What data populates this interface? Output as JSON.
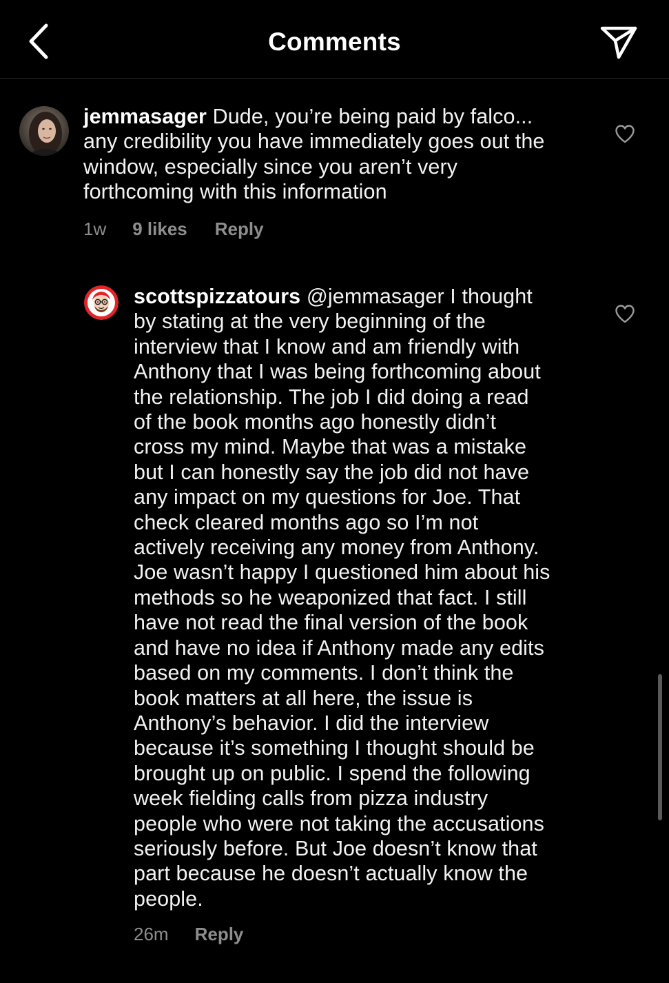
{
  "header": {
    "title": "Comments",
    "back_icon": "chevron-left-icon",
    "share_icon": "paper-plane-icon"
  },
  "comments": [
    {
      "username": "jemmasager",
      "text": "Dude, you’re being paid by falco...\nany credibility you have immediately goes out the\nwindow, especially since you aren’t very\nforthcoming with this information",
      "time": "1w",
      "likes": "9 likes",
      "reply_label": "Reply"
    },
    {
      "username": "scottspizzatours",
      "text": "@jemmasager I thought\nby stating at the very beginning of the\ninterview that I know and am friendly with\nAnthony that I was being forthcoming about\nthe relationship. The job I did doing a read\nof the book months ago honestly didn’t\ncross my mind. Maybe that was a mistake\nbut I can honestly say the job did not have\nany impact on my questions for Joe. That\ncheck cleared months ago so I’m not\nactively receiving any money from Anthony.\nJoe wasn’t happy I questioned him about his\nmethods so he weaponized that fact. I still\nhave not read the final version of the book\nand have no idea if Anthony made any edits\nbased on my comments. I don’t think the\nbook matters at all here, the issue is\nAnthony’s behavior. I did the interview\nbecause it’s something I thought should be\nbrought up on public. I spend the following\nweek fielding calls from pizza industry\npeople who were not taking the accusations\nseriously before. But Joe doesn’t know that\npart because he doesn’t actually know the\npeople.",
      "time": "26m",
      "reply_label": "Reply"
    }
  ],
  "colors": {
    "background": "#000000",
    "text": "#f2f2f2",
    "meta": "#8e8e8e",
    "divider": "#262626",
    "pizza_avatar_red": "#e0262b"
  }
}
